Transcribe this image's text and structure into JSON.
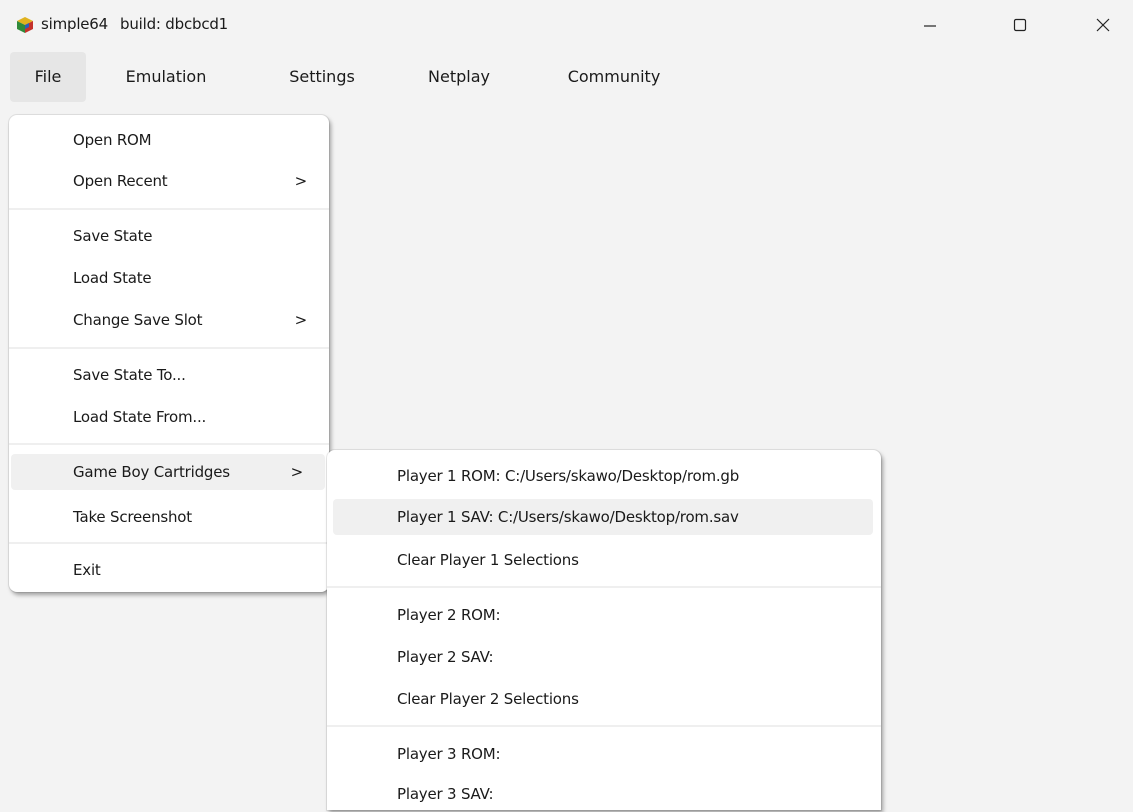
{
  "window": {
    "app_name": "simple64",
    "build": "build: dbcbcd1",
    "icon": "cube-logo-icon"
  },
  "menubar": {
    "items": [
      "File",
      "Emulation",
      "Settings",
      "Netplay",
      "Community"
    ],
    "active": "File"
  },
  "file_menu": {
    "items": {
      "open_rom": "Open ROM",
      "open_recent": "Open Recent",
      "save_state": "Save State",
      "load_state": "Load State",
      "change_save_slot": "Change Save Slot",
      "save_state_to": "Save State To...",
      "load_state_from": "Load State From...",
      "game_boy_cartridges": "Game Boy Cartridges",
      "take_screenshot": "Take Screenshot",
      "exit": "Exit"
    },
    "submenu_arrow": ">"
  },
  "gb_submenu": {
    "items": {
      "p1_rom": "Player 1 ROM: C:/Users/skawo/Desktop/rom.gb",
      "p1_sav": "Player 1 SAV: C:/Users/skawo/Desktop/rom.sav",
      "clear_p1": "Clear Player 1 Selections",
      "p2_rom": "Player 2 ROM:",
      "p2_sav": "Player 2 SAV:",
      "clear_p2": "Clear Player 2 Selections",
      "p3_rom": "Player 3 ROM:",
      "p3_sav": "Player 3 SAV:"
    },
    "highlighted": "p1_sav"
  },
  "colors": {
    "background": "#f3f3f3",
    "menu_bg": "#ffffff",
    "highlight": "#f0f0f0"
  }
}
